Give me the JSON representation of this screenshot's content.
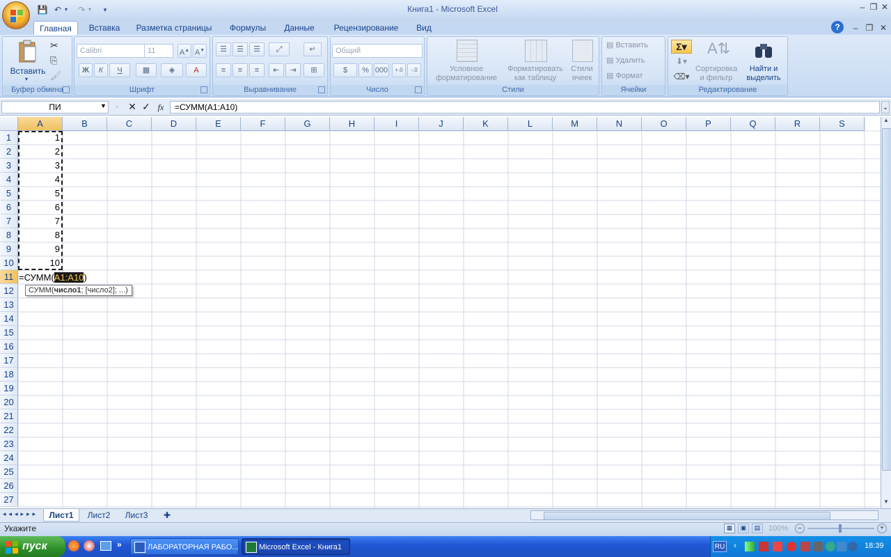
{
  "title": "Книга1 - Microsoft Excel",
  "tabs": [
    "Главная",
    "Вставка",
    "Разметка страницы",
    "Формулы",
    "Данные",
    "Рецензирование",
    "Вид"
  ],
  "ribbon": {
    "clipboard": {
      "label": "Буфер обмена",
      "paste": "Вставить"
    },
    "font": {
      "label": "Шрифт",
      "font_name": "Calibri",
      "font_size": "11",
      "bold": "Ж",
      "italic": "К",
      "underline": "Ч"
    },
    "alignment": {
      "label": "Выравнивание"
    },
    "number": {
      "label": "Число",
      "format": "Общий",
      "percent": "%",
      "thousands": "000"
    },
    "styles": {
      "label": "Стили",
      "cond_format_1": "Условное",
      "cond_format_2": "форматирование",
      "as_table_1": "Форматировать",
      "as_table_2": "как таблицу",
      "cell_styles_1": "Стили",
      "cell_styles_2": "ячеек"
    },
    "cells": {
      "label": "Ячейки",
      "insert": "Вставить",
      "delete": "Удалить",
      "format": "Формат"
    },
    "editing": {
      "label": "Редактирование",
      "sort_1": "Сортировка",
      "sort_2": "и фильтр",
      "find_1": "Найти и",
      "find_2": "выделить"
    }
  },
  "formula_bar": {
    "name_box": "ПИ",
    "fx": "fx",
    "formula": "=СУММ(A1:A10)"
  },
  "columns": [
    "A",
    "B",
    "C",
    "D",
    "E",
    "F",
    "G",
    "H",
    "I",
    "J",
    "K",
    "L",
    "M",
    "N",
    "O",
    "P",
    "Q",
    "R",
    "S"
  ],
  "rows": [
    "1",
    "2",
    "3",
    "4",
    "5",
    "6",
    "7",
    "8",
    "9",
    "10",
    "11",
    "12",
    "13",
    "14",
    "15",
    "16",
    "17",
    "18",
    "19",
    "20",
    "21",
    "22",
    "23",
    "24",
    "25",
    "26",
    "27"
  ],
  "cells_a": [
    "1",
    "2",
    "3",
    "4",
    "5",
    "6",
    "7",
    "8",
    "9",
    "10"
  ],
  "edit_cell": {
    "prefix": "=СУММ(",
    "range": "A1:A10",
    "suffix": ")"
  },
  "tooltip": {
    "func": "СУММ(",
    "arg1": "число1",
    "rest": "; [число2]; ...)"
  },
  "sheets": [
    "Лист1",
    "Лист2",
    "Лист3"
  ],
  "status": {
    "mode": "Укажите",
    "zoom": "100%"
  },
  "taskbar": {
    "start": "пуск",
    "item1": "ЛАБОРАТОРНАЯ РАБО...",
    "item2": "Microsoft Excel - Книга1",
    "lang": "RU",
    "clock": "18:39"
  },
  "colors": {
    "accent": "#15428b",
    "selection_header": "#f1c15f",
    "range_highlight": "#1a1a1a",
    "range_text": "#f7c64a"
  }
}
